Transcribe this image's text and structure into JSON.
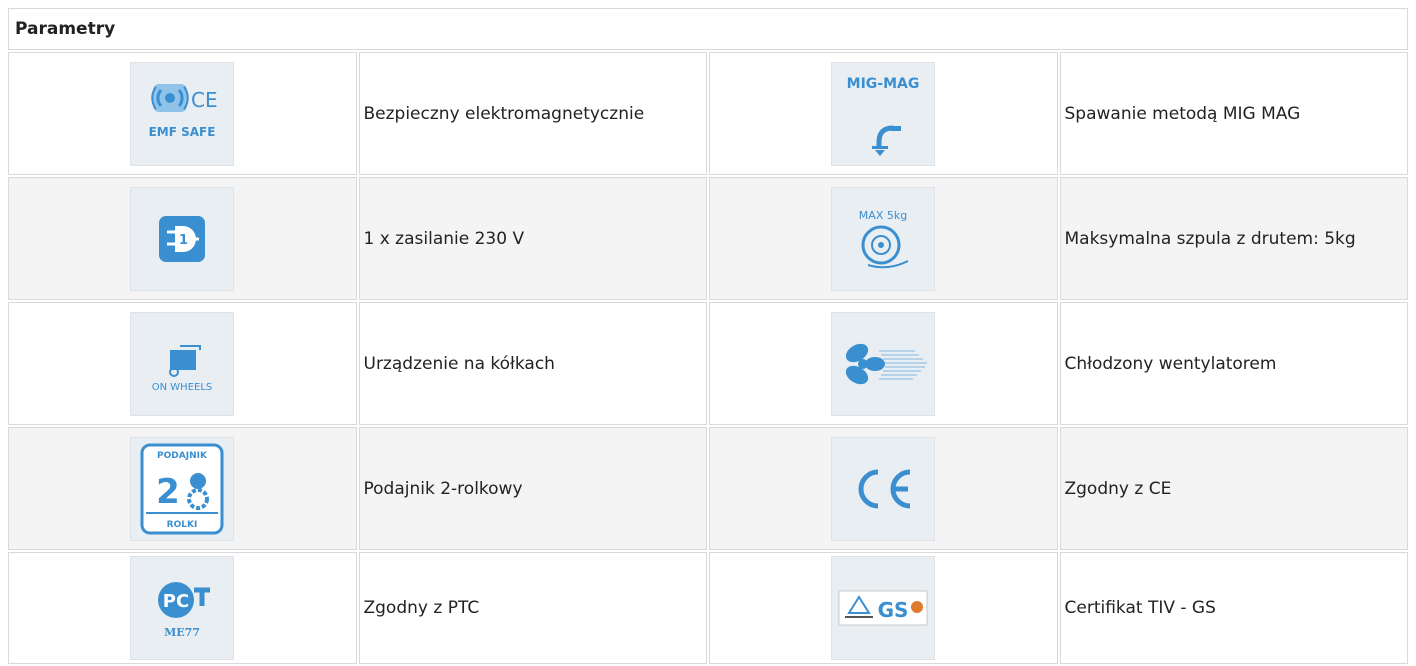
{
  "table": {
    "header": "Parametry",
    "rows": [
      [
        {
          "icon": "emf-safe-icon",
          "icon_text": "EMF SAFE",
          "label": "Bezpieczny elektromagnetycznie"
        },
        {
          "icon": "mig-mag-icon",
          "icon_text": "MIG-MAG",
          "label": "Spawanie metodą MIG MAG"
        }
      ],
      [
        {
          "icon": "power-plug-icon",
          "label": "1 x zasilanie 230 V"
        },
        {
          "icon": "wire-spool-icon",
          "icon_text": "MAX 5kg",
          "label": "Maksymalna szpula z drutem: 5kg"
        }
      ],
      [
        {
          "icon": "on-wheels-icon",
          "icon_text": "ON WHEELS",
          "label": "Urządzenie na kółkach"
        },
        {
          "icon": "fan-cooling-icon",
          "label": "Chłodzony wentylatorem"
        }
      ],
      [
        {
          "icon": "feeder-2-rollers-icon",
          "icon_text": "PODAJNIK ROLKI",
          "label": "Podajnik 2-rolkowy"
        },
        {
          "icon": "ce-mark-icon",
          "label": "Zgodny z CE"
        }
      ],
      [
        {
          "icon": "ptc-mark-icon",
          "icon_text": "ME77",
          "label": "Zgodny z PTC"
        },
        {
          "icon": "tuv-gs-icon",
          "label": "Certifikat TIV - GS"
        }
      ]
    ]
  },
  "colors": {
    "icon_blue": "#3a8fd0",
    "tile_bg": "#e9eef3",
    "row_alt": "#f4f4f4"
  }
}
